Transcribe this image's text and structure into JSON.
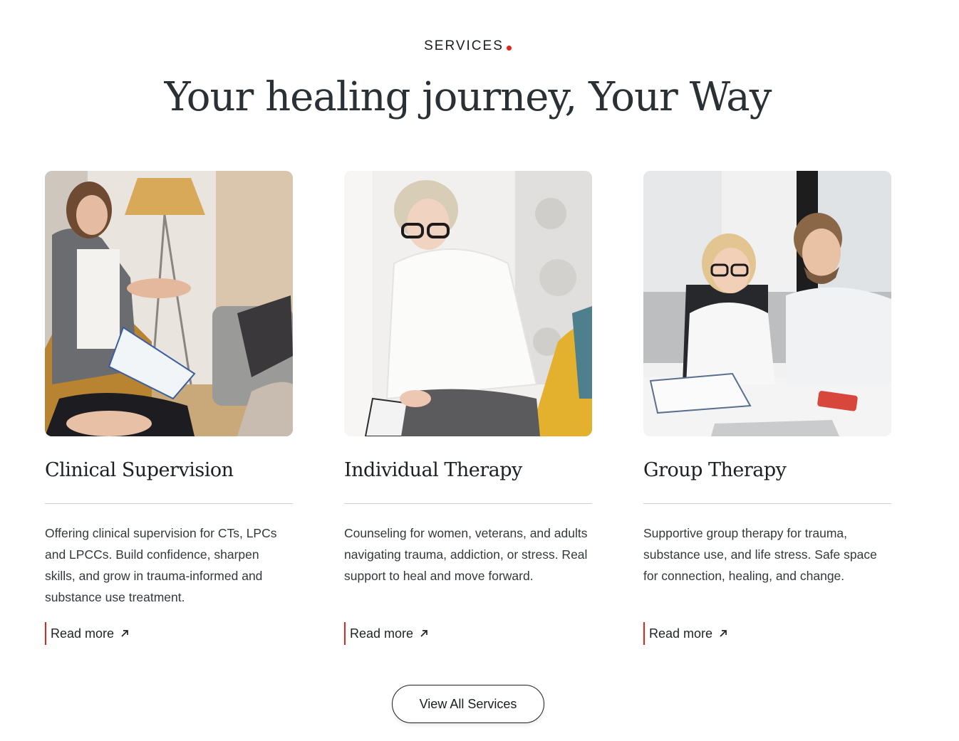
{
  "section": {
    "eyebrow": "SERVICES",
    "headline": "Your healing journey, Your Way",
    "accent_color": "#e2261d"
  },
  "cards": [
    {
      "title": "Clinical Supervision",
      "image": "therapist-session-photo",
      "description": "Offering clinical supervision for CTs, LPCs and LPCCs. Build confidence, sharpen skills, and grow in trauma-informed and substance use treatment.",
      "link_label": "Read more",
      "link_icon": "arrow-up-right-icon"
    },
    {
      "title": "Individual Therapy",
      "image": "counselor-writing-photo",
      "description": "Counseling for women, veterans, and adults navigating trauma, addiction, or stress. Real support to heal and move forward.",
      "link_label": "Read more",
      "link_icon": "arrow-up-right-icon"
    },
    {
      "title": "Group Therapy",
      "image": "group-meeting-photo",
      "description": "Supportive group therapy for trauma, substance use, and life stress. Safe space for connection, healing, and change.",
      "link_label": "Read more",
      "link_icon": "arrow-up-right-icon"
    }
  ],
  "cta": {
    "label": "View All Services"
  }
}
